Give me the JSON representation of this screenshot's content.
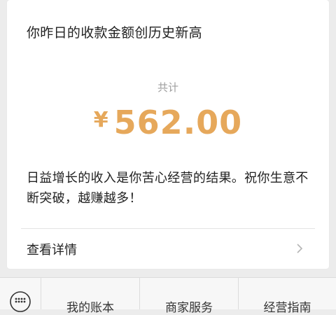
{
  "card": {
    "headline": "你昨日的收款金额创历史新高",
    "total_label": "共计",
    "currency_symbol": "¥",
    "amount": "562.00",
    "message": "日益增长的收入是你苦心经营的结果。祝你生意不断突破，越赚越多！",
    "details_label": "查看详情"
  },
  "bottom_bar": {
    "menus": [
      {
        "label": "我的账本"
      },
      {
        "label": "商家服务"
      },
      {
        "label": "经营指南"
      }
    ]
  },
  "colors": {
    "amount": "#e6a85b",
    "background": "#ececec",
    "card": "#ffffff"
  }
}
